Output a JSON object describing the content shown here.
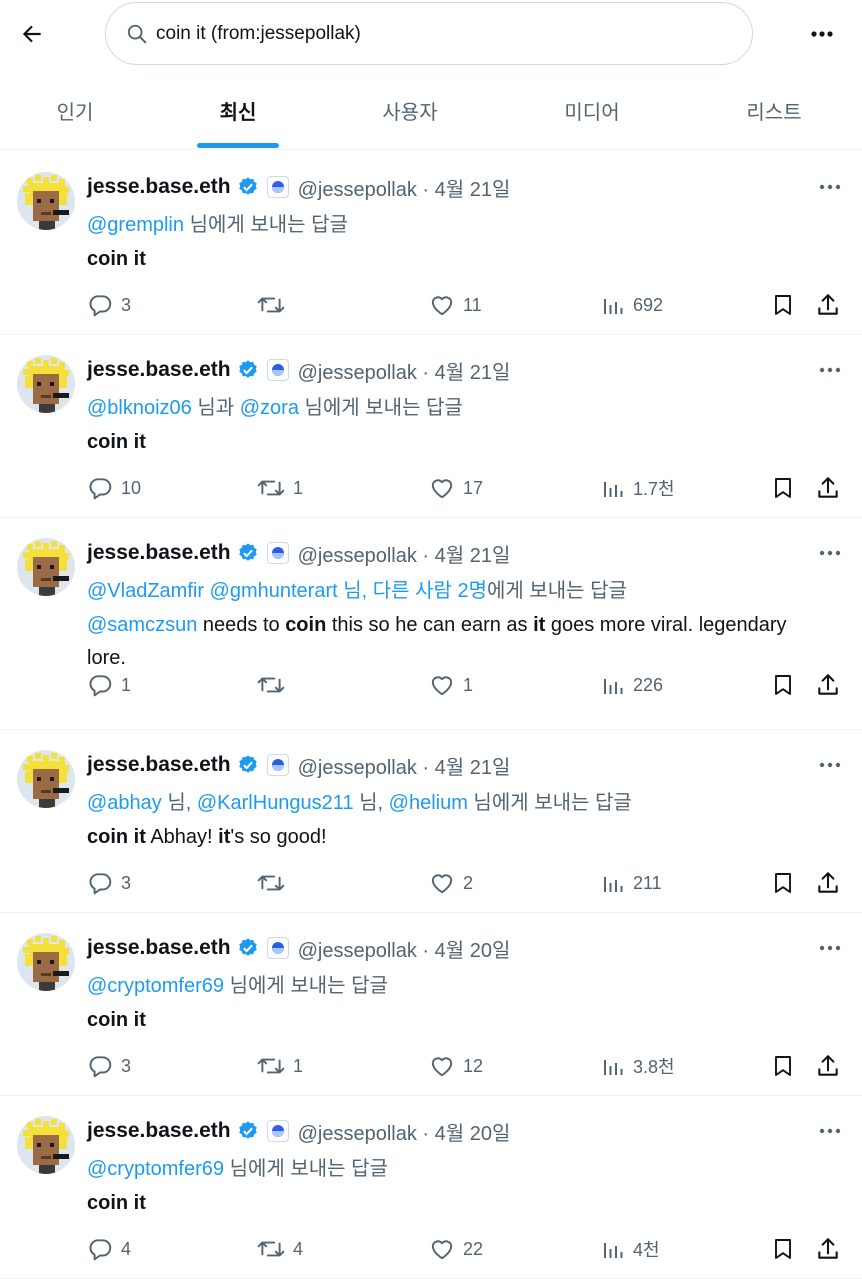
{
  "search": {
    "query": "coin it (from:jessepollak)"
  },
  "tabs": [
    {
      "label": "인기"
    },
    {
      "label": "최신"
    },
    {
      "label": "사용자"
    },
    {
      "label": "미디어"
    },
    {
      "label": "리스트"
    }
  ],
  "colors": {
    "accent": "#1d9bf0",
    "muted": "#536471",
    "text": "#0f1419"
  },
  "tweets": [
    {
      "name": "jesse.base.eth",
      "handle_date": "@jessepollak · 4월 21일",
      "reply_parts": [
        {
          "text": "@gremplin",
          "mention": true
        },
        {
          "text": " 님에게 보내는 답글",
          "mention": false
        }
      ],
      "body_parts": [
        {
          "text": "coin it",
          "bold": true
        }
      ],
      "replies": "3",
      "retweets": "",
      "likes": "11",
      "views": "692"
    },
    {
      "name": "jesse.base.eth",
      "handle_date": "@jessepollak · 4월 21일",
      "reply_parts": [
        {
          "text": "@blknoiz06",
          "mention": true
        },
        {
          "text": " 님과 ",
          "mention": false
        },
        {
          "text": "@zora",
          "mention": true
        },
        {
          "text": " 님에게 보내는 답글",
          "mention": false
        }
      ],
      "body_parts": [
        {
          "text": "coin it",
          "bold": true
        }
      ],
      "replies": "10",
      "retweets": "1",
      "likes": "17",
      "views": "1.7천"
    },
    {
      "name": "jesse.base.eth",
      "handle_date": "@jessepollak · 4월 21일",
      "reply_parts": [
        {
          "text": "@VladZamfir @gmhunterart  님, 다른 사람 2명",
          "mention": true
        },
        {
          "text": "에게 보내는 답글",
          "mention": false
        }
      ],
      "body_parts": [
        {
          "text": "@samczsun",
          "mention": true
        },
        {
          "text": " needs to ",
          "bold": false
        },
        {
          "text": "coin",
          "bold": true
        },
        {
          "text": " this so he can earn as ",
          "bold": false
        },
        {
          "text": "it",
          "bold": true
        },
        {
          "text": " goes more viral. legendary lore.",
          "bold": false
        }
      ],
      "replies": "1",
      "retweets": "",
      "likes": "1",
      "views": "226"
    },
    {
      "name": "jesse.base.eth",
      "handle_date": "@jessepollak · 4월 21일",
      "reply_parts": [
        {
          "text": "@abhay",
          "mention": true
        },
        {
          "text": " 님, ",
          "mention": false
        },
        {
          "text": "@KarlHungus211",
          "mention": true
        },
        {
          "text": " 님, ",
          "mention": false
        },
        {
          "text": "@helium",
          "mention": true
        },
        {
          "text": " 님에게 보내는 답글",
          "mention": false
        }
      ],
      "body_parts": [
        {
          "text": "coin it",
          "bold": true
        },
        {
          "text": " Abhay! ",
          "bold": false
        },
        {
          "text": "it",
          "bold": true
        },
        {
          "text": "'s so good!",
          "bold": false
        }
      ],
      "replies": "3",
      "retweets": "",
      "likes": "2",
      "views": "211"
    },
    {
      "name": "jesse.base.eth",
      "handle_date": "@jessepollak · 4월 20일",
      "reply_parts": [
        {
          "text": "@cryptomfer69",
          "mention": true
        },
        {
          "text": " 님에게 보내는 답글",
          "mention": false
        }
      ],
      "body_parts": [
        {
          "text": "coin it",
          "bold": true
        }
      ],
      "replies": "3",
      "retweets": "1",
      "likes": "12",
      "views": "3.8천"
    },
    {
      "name": "jesse.base.eth",
      "handle_date": "@jessepollak · 4월 20일",
      "reply_parts": [
        {
          "text": "@cryptomfer69",
          "mention": true
        },
        {
          "text": " 님에게 보내는 답글",
          "mention": false
        }
      ],
      "body_parts": [
        {
          "text": "coin it",
          "bold": true
        }
      ],
      "replies": "4",
      "retweets": "4",
      "likes": "22",
      "views": "4천"
    }
  ]
}
